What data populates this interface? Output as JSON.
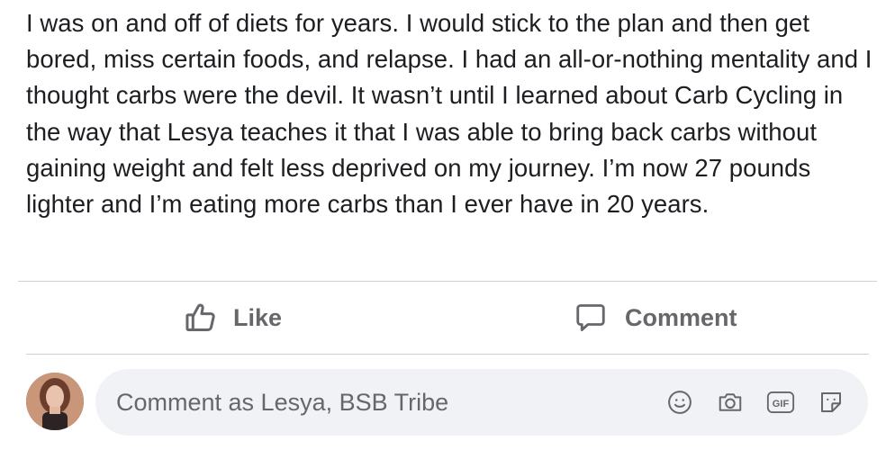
{
  "post": {
    "text": "I was on and off of diets for years. I would stick to the plan and then get bored, miss certain foods, and relapse. I had an all-or-nothing mentality and I thought carbs were the devil. It wasn’t until I learned about Carb Cycling in the way that Lesya teaches it that I was able to bring back carbs without gaining weight and felt less deprived on my journey. I’m now 27 pounds lighter and I’m eating more carbs than I ever have in 20 years."
  },
  "actions": {
    "like_label": "Like",
    "like_icon": "thumbs-up-icon",
    "comment_label": "Comment",
    "comment_icon": "speech-bubble-icon"
  },
  "composer": {
    "placeholder": "Comment as Lesya, BSB Tribe",
    "icons": [
      "smiley-icon",
      "camera-icon",
      "gif-icon",
      "sticker-icon"
    ]
  },
  "colors": {
    "text": "#1c1e21",
    "secondary": "#65676b",
    "input_bg": "#f0f2f5",
    "divider": "#cfd1d5"
  }
}
